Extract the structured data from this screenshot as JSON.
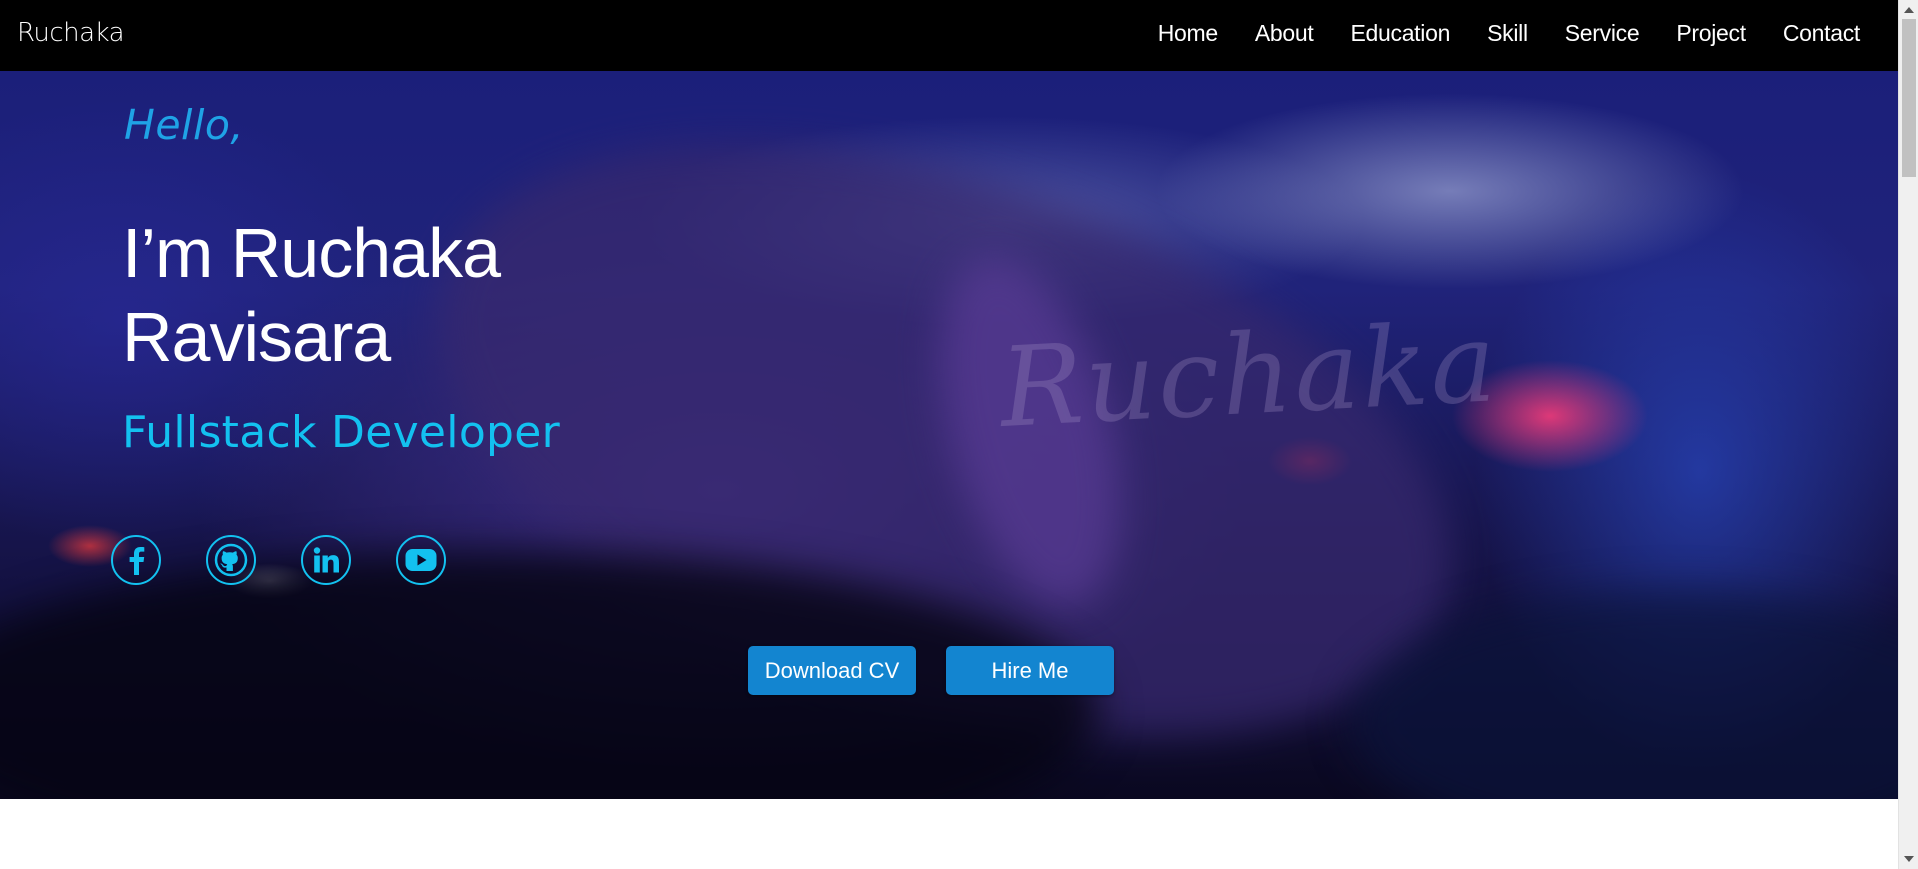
{
  "nav": {
    "brand": "Ruchaka",
    "links": [
      "Home",
      "About",
      "Education",
      "Skill",
      "Service",
      "Project",
      "Contact"
    ]
  },
  "hero": {
    "greeting": "Hello,",
    "name": "I’m Ruchaka Ravisara",
    "role": "Fullstack Developer",
    "watermark": "Ruchaka",
    "socials": [
      "facebook-icon",
      "github-icon",
      "linkedin-icon",
      "youtube-icon"
    ],
    "buttons": {
      "download_cv": "Download CV",
      "hire_me": "Hire Me"
    }
  },
  "colors": {
    "navbar_bg": "#000000",
    "accent_cyan": "#13c1f0",
    "greeting_blue": "#1fa3e6",
    "button_blue": "#1385d0"
  }
}
